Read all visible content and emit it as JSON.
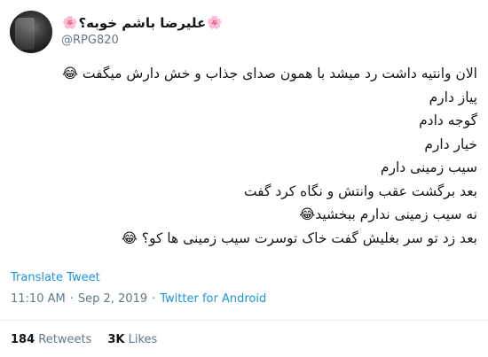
{
  "user": {
    "display_name": "علیرضا باشم خوبه؟",
    "handle": "@RPG820",
    "name_emoji": "🌸"
  },
  "tweet": {
    "lines": [
      "الان وانتیه داشت رد میشد با همون صدای جذاب و خش دارش میگفت 😂",
      "پیاز دارم",
      "گوجه دادم",
      "خیار دارم",
      "سیب زمینی دارم",
      "بعد برگشت عقب وانتش و نگاه کرد گفت",
      "نه سیب زمینی ندارم ببخشید😂",
      "بعد زد تو سر بغلیش گفت خاک توسرت سیب زمینی ها کو؟ 😂"
    ]
  },
  "translate_label": "Translate Tweet",
  "meta": {
    "time": "11:10 AM",
    "separator": "·",
    "date": "Sep 2, 2019",
    "source": "Twitter for Android"
  },
  "stats": {
    "retweets_count": "184",
    "retweets_label": "Retweets",
    "likes_count": "3K",
    "likes_label": "Likes"
  }
}
